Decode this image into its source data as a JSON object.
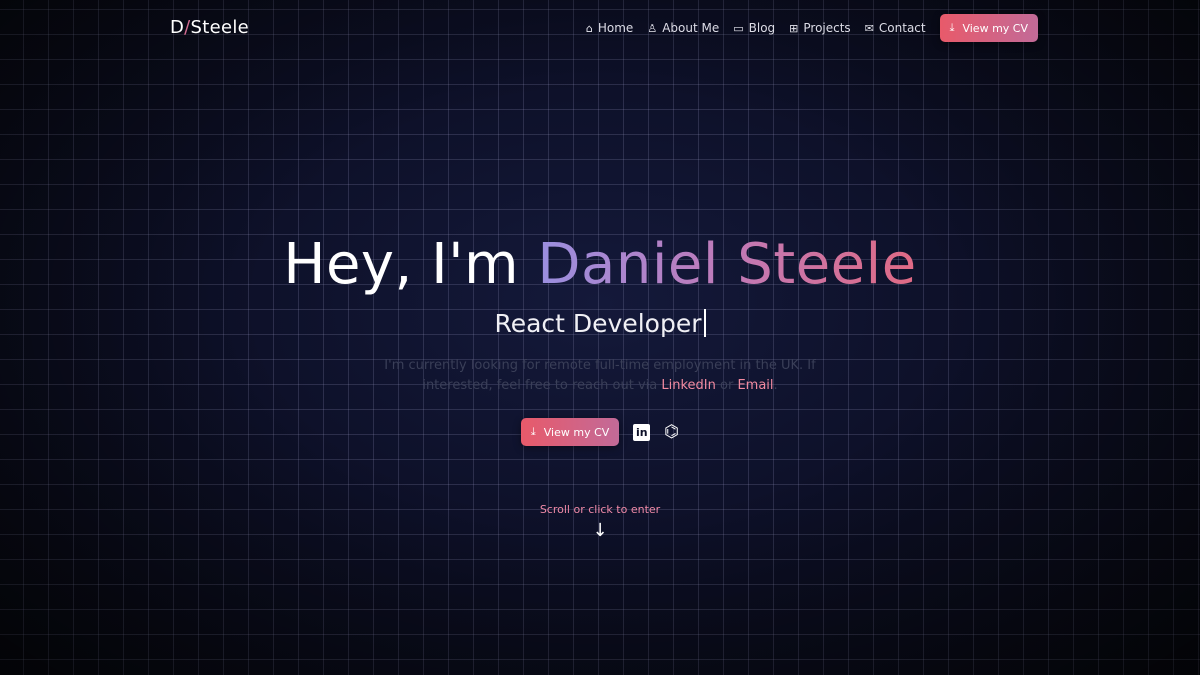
{
  "logo": {
    "first": "D",
    "slash": "/",
    "last": "Steele"
  },
  "nav": {
    "items": [
      {
        "icon": "home-icon",
        "glyph": "⌂",
        "label": "Home"
      },
      {
        "icon": "user-icon",
        "glyph": "♙",
        "label": "About Me"
      },
      {
        "icon": "chat-icon",
        "glyph": "▭",
        "label": "Blog"
      },
      {
        "icon": "grid-icon",
        "glyph": "⊞",
        "label": "Projects"
      },
      {
        "icon": "mail-icon",
        "glyph": "✉",
        "label": "Contact"
      }
    ],
    "cv_label": "View my CV"
  },
  "hero": {
    "greeting": "Hey, I'm",
    "name": "Daniel Steele",
    "role": "React Developer",
    "desc_1": "I'm currently looking for remote full-time employment in the UK. If interested, feel free to reach out via",
    "linkedin": "LinkedIn",
    "or": "or",
    "email": "Email",
    "period": ".",
    "cv_label": "View my CV",
    "linkedin_icon": "in",
    "github_icon": "⌬"
  },
  "scroll": {
    "label": "Scroll or click to enter",
    "arrow": "↓"
  },
  "colors": {
    "accent": "#e85a6a",
    "accent2": "#c26a98",
    "bg": "#0d1028"
  }
}
